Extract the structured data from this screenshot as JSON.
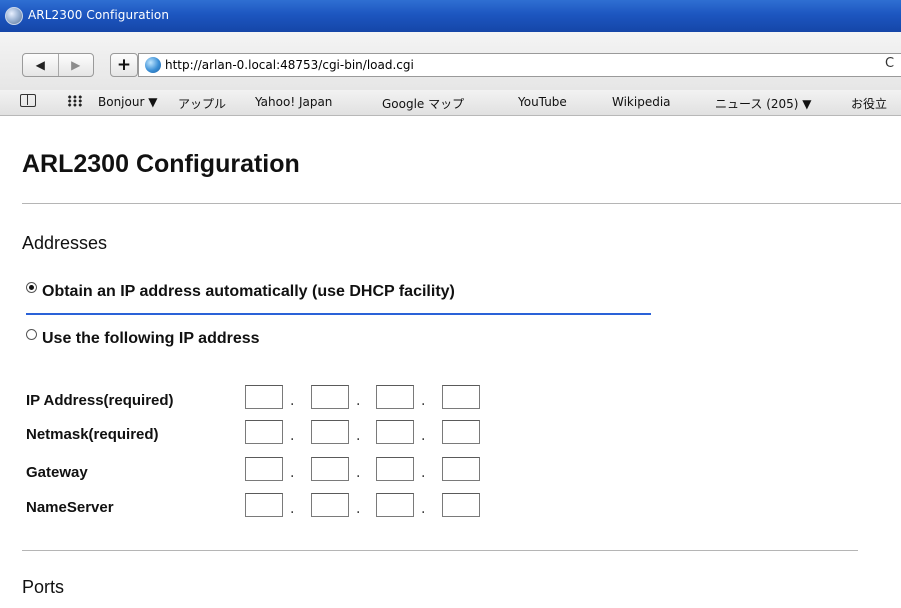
{
  "window": {
    "title": "ARL2300 Configuration"
  },
  "toolbar": {
    "back_glyph": "◀",
    "forward_glyph": "▶",
    "add_glyph": "+",
    "url": "http://arlan-0.local:48753/cgi-bin/load.cgi",
    "reload_glyph": "C"
  },
  "bookmarks": [
    {
      "label": "Bonjour ▼"
    },
    {
      "label": "アップル"
    },
    {
      "label": "Yahoo! Japan"
    },
    {
      "label": "Google マップ"
    },
    {
      "label": "YouTube"
    },
    {
      "label": "Wikipedia"
    },
    {
      "label": "ニュース (205) ▼"
    },
    {
      "label": "お役立"
    }
  ],
  "page": {
    "title": "ARL2300 Configuration",
    "addresses_heading": "Addresses",
    "radio_dhcp_label": "Obtain an IP address automatically (use DHCP facility)",
    "radio_static_label": "Use the following IP address",
    "selected_mode": "dhcp",
    "fields": [
      {
        "label": "IP Address(required)",
        "octets": [
          "",
          "",
          "",
          ""
        ]
      },
      {
        "label": "Netmask(required)",
        "octets": [
          "",
          "",
          "",
          ""
        ]
      },
      {
        "label": "Gateway",
        "octets": [
          "",
          "",
          "",
          ""
        ]
      },
      {
        "label": "NameServer",
        "octets": [
          "",
          "",
          "",
          ""
        ]
      }
    ],
    "ports_heading": "Ports"
  },
  "colors": {
    "titlebar_blue": "#1d56c0",
    "focus_underline": "#2a62d8"
  },
  "icons": {
    "window": "app-globe-icon",
    "site": "globe-icon",
    "bookmarks_book": "book-icon",
    "bookmarks_grid": "grid-icon"
  }
}
